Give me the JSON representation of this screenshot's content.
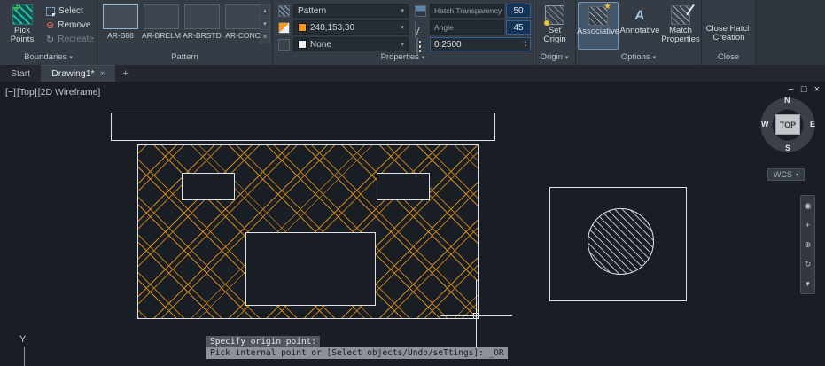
{
  "colors": {
    "hatch_orange": "#F8991E",
    "check_green": "#4DB04F",
    "highlight_blue": "#6F93B5"
  },
  "ribbon": {
    "boundaries": {
      "label": "Boundaries",
      "pick_points": "Pick Points",
      "select": "Select",
      "remove": "Remove",
      "recreate": "Recreate"
    },
    "pattern": {
      "label": "Pattern",
      "swatches": [
        "AR-B88",
        "AR-BRELM",
        "AR-BRSTD",
        "AR-CONC"
      ]
    },
    "properties": {
      "label": "Properties",
      "pattern_type": "Pattern",
      "color_value": "248,153,30",
      "background_value": "None",
      "transparency_label": "Hatch Transparency",
      "transparency_value": "50",
      "angle_label": "Angle",
      "angle_value": "45",
      "scale_value": "0.2500"
    },
    "origin": {
      "label": "Origin",
      "set_origin": "Set Origin"
    },
    "options": {
      "label": "Options",
      "associative": "Associative",
      "annotative": "Annotative",
      "match_properties": "Match Properties"
    },
    "close": {
      "label": "Close",
      "button": "Close Hatch Creation"
    }
  },
  "tabs": {
    "start": "Start",
    "drawing": "Drawing1*",
    "close_glyph": "×",
    "add_glyph": "+"
  },
  "canvas": {
    "viewport": {
      "collapse": "[−]",
      "view": "[Top]",
      "visual_style": "[2D Wireframe]"
    },
    "window": {
      "minimize": "−",
      "restore": "□",
      "close": "×"
    },
    "viewcube": {
      "n": "N",
      "s": "S",
      "w": "W",
      "e": "E",
      "top": "TOP",
      "wcs": "WCS"
    },
    "axis_y": "Y",
    "prompt_history": "Specify origin point:",
    "prompt_current": "Pick internal point or [Select objects/Undo/seTtings]: _OR"
  },
  "glyphs": {
    "dropdown": "▾",
    "up": "▴",
    "menu": "≡",
    "plus": "+",
    "star": "★",
    "wheel": "◉",
    "pan": "+",
    "zoom": "⊕",
    "orbit": "↻",
    "remove": "⊖",
    "refresh": "↻",
    "annot_a": "A"
  }
}
